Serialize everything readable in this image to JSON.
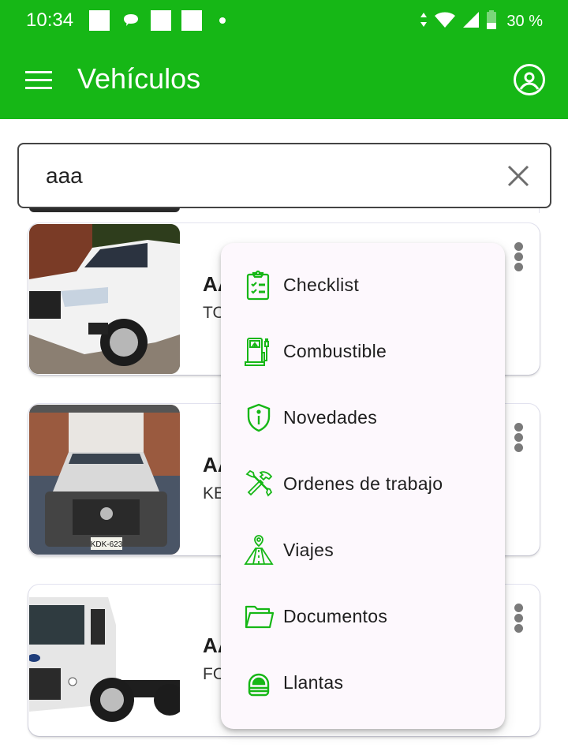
{
  "status_bar": {
    "time": "10:34",
    "battery_percent": "30 %",
    "icons": [
      "notification-square-icon",
      "chat-bubble-icon",
      "notification-square-icon",
      "notification-square-icon",
      "dot-icon",
      "data-arrows-icon",
      "wifi-icon",
      "signal-icon",
      "battery-icon"
    ]
  },
  "app_bar": {
    "title": "Vehículos",
    "menu_icon": "hamburger-menu-icon",
    "account_icon": "account-circle-icon"
  },
  "search": {
    "value": "aaa",
    "clear_icon": "close-icon"
  },
  "vehicles": [
    {
      "plate": "AA",
      "brand": "TO",
      "photo": "white-pickup-truck",
      "menu_icon": "more-vert-icon"
    },
    {
      "plate": "AA",
      "brand": "KE",
      "photo": "grey-pickup-with-box",
      "plate_on_photo": "KDK-623",
      "menu_icon": "more-vert-icon"
    },
    {
      "plate": "AA",
      "brand": "FO",
      "photo": "white-cargo-truck",
      "menu_icon": "more-vert-icon"
    }
  ],
  "context_menu": {
    "accent_color": "#16b716",
    "items": [
      {
        "label": "Checklist",
        "icon": "clipboard-check-icon"
      },
      {
        "label": "Combustible",
        "icon": "fuel-pump-icon"
      },
      {
        "label": "Novedades",
        "icon": "shield-info-icon"
      },
      {
        "label": "Ordenes de trabajo",
        "icon": "tools-icon"
      },
      {
        "label": "Viajes",
        "icon": "road-pin-icon"
      },
      {
        "label": "Documentos",
        "icon": "folder-open-icon"
      },
      {
        "label": "Llantas",
        "icon": "tire-icon"
      }
    ]
  },
  "colors": {
    "primary": "#16b716",
    "menu_background": "#fdf8fd",
    "text": "#1e1e1e"
  }
}
